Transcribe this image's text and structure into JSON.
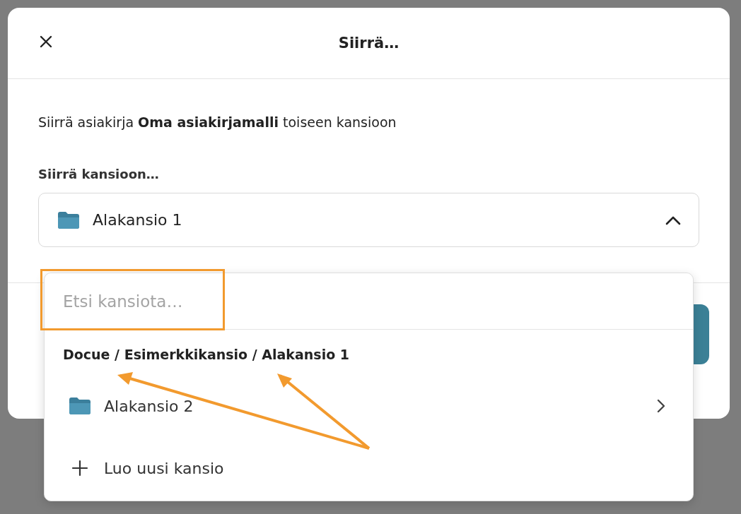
{
  "dialog": {
    "title": "Siirrä…",
    "description": "Siirrä asiakirja **Oma asiakirjamalli** toiseen kansioon",
    "field_label": "Siirrä kansioon…",
    "select": {
      "value": "Alakansio 1",
      "expanded": true
    }
  },
  "dropdown": {
    "search": {
      "placeholder": "Etsi kansiota…"
    },
    "breadcrumb": "Docue / Esimerkkikansio / Alakansio 1",
    "items": [
      {
        "kind": "folder",
        "label": "Alakansio 2"
      },
      {
        "kind": "create",
        "label": "Luo uusi kansio"
      }
    ]
  }
}
